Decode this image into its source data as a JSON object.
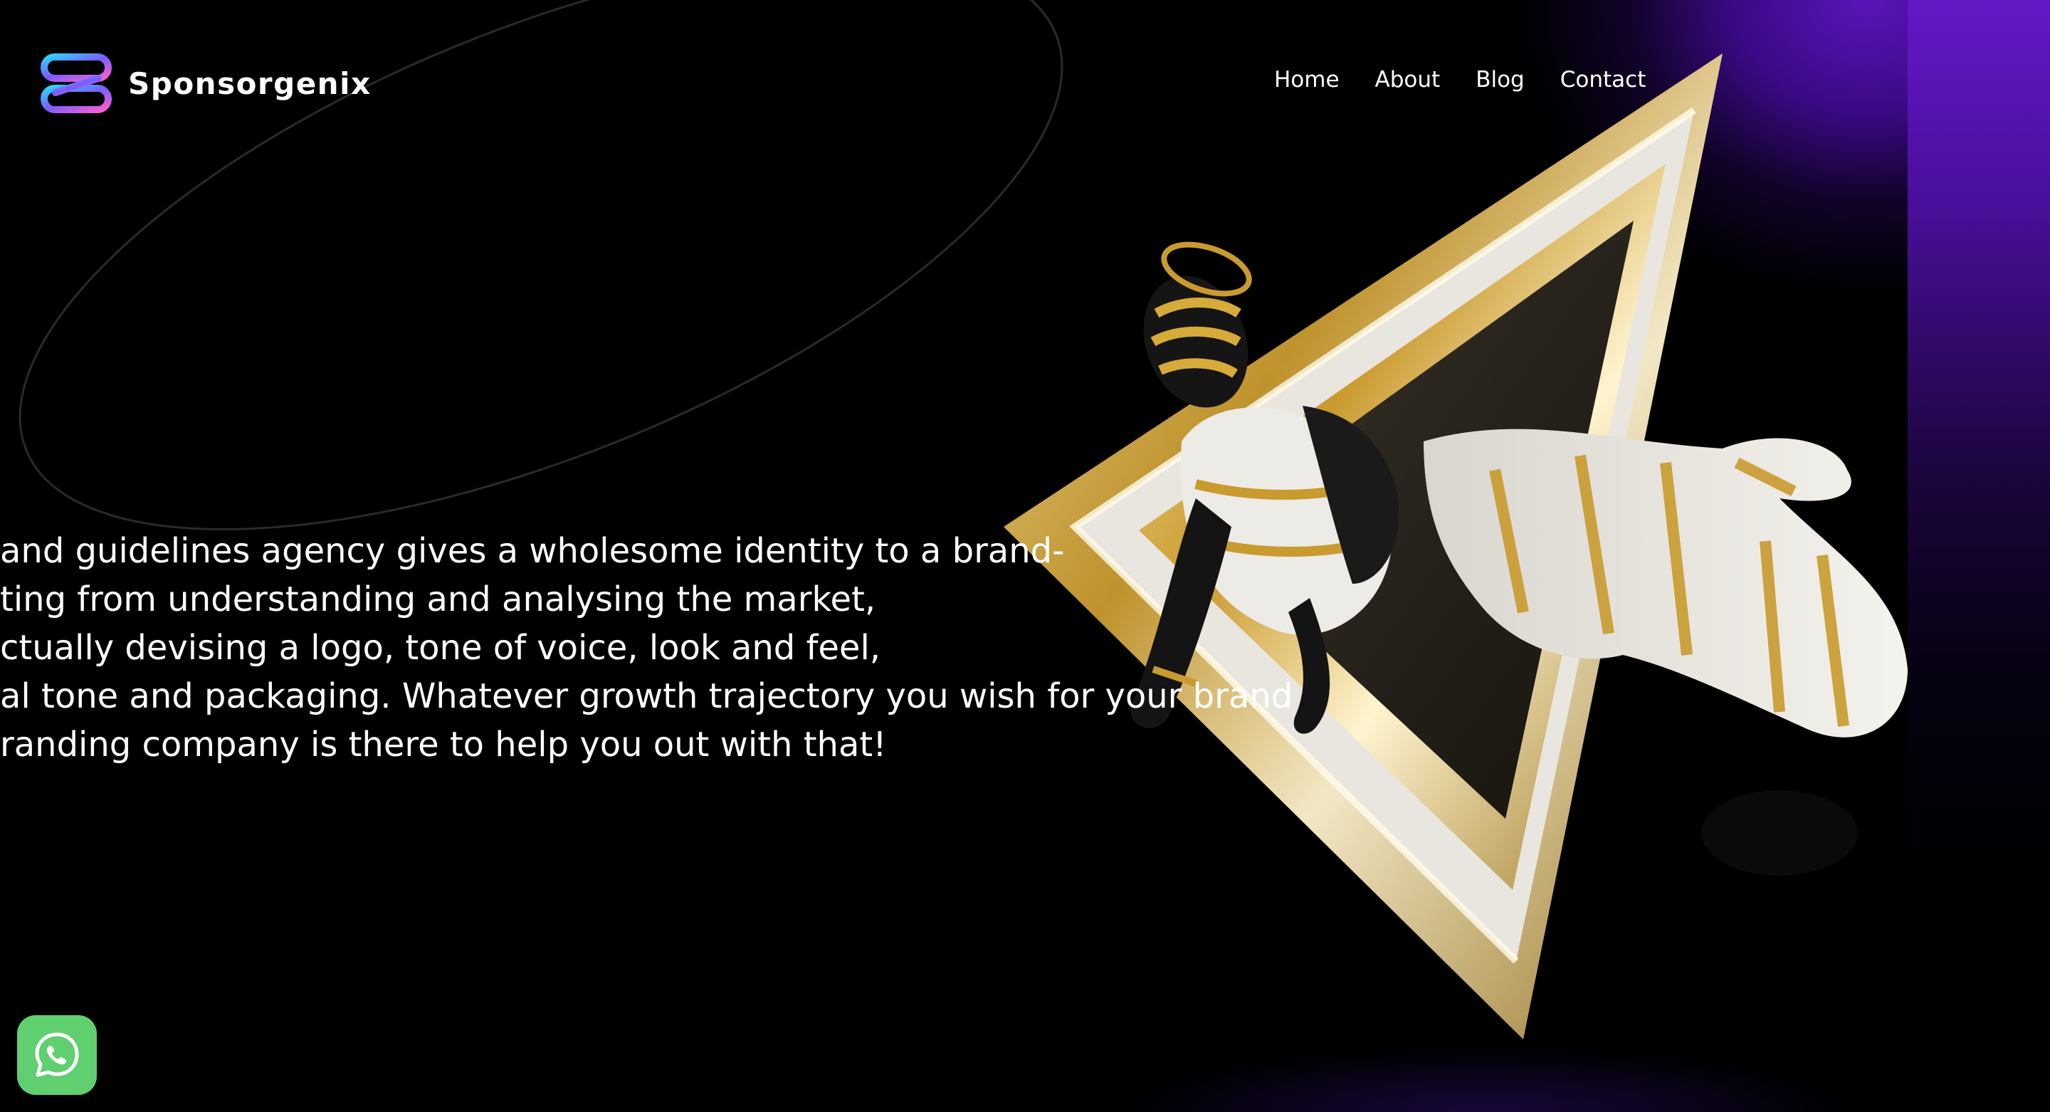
{
  "brand": {
    "name": "Sponsorgenix"
  },
  "nav": {
    "items": [
      {
        "label": "Home"
      },
      {
        "label": "About"
      },
      {
        "label": "Blog"
      },
      {
        "label": "Contact"
      }
    ]
  },
  "hero": {
    "lines": [
      "and guidelines agency gives a wholesome identity to a brand-",
      "ting from understanding and analysing the market,",
      "ctually devising a logo, tone of voice, look and feel,",
      "al tone and packaging. Whatever growth trajectory you wish for your brand",
      "randing company is there to help you out with that!"
    ]
  },
  "icons": {
    "logo": "sponsorgenix-logo-icon",
    "whatsapp": "whatsapp-icon",
    "artwork": "golden-triangle-figure-artwork"
  },
  "colors": {
    "background": "#000000",
    "accent_purple": "#5a14b8",
    "whatsapp_green": "#5fcf6f",
    "gold": "#d8b04a"
  }
}
